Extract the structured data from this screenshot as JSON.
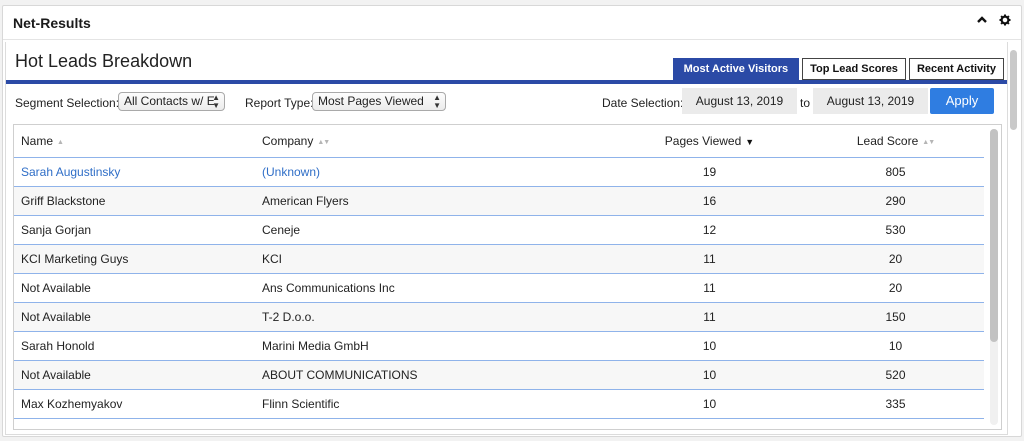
{
  "widget": {
    "title": "Net-Results"
  },
  "panel": {
    "title": "Hot Leads Breakdown"
  },
  "tabs": [
    {
      "label": "Most Active Visitors",
      "active": true
    },
    {
      "label": "Top Lead Scores",
      "active": false
    },
    {
      "label": "Recent Activity",
      "active": false
    }
  ],
  "controls": {
    "segment_label": "Segment Selection:",
    "segment_value": "All Contacts w/ E",
    "report_label": "Report Type:",
    "report_value": "Most Pages Viewed",
    "date_label": "Date Selection:",
    "date_from": "August 13, 2019",
    "date_to_label": "to",
    "date_to": "August 13, 2019",
    "apply_label": "Apply"
  },
  "table": {
    "headers": {
      "name": "Name",
      "company": "Company",
      "pages": "Pages Viewed",
      "score": "Lead Score"
    },
    "rows": [
      {
        "name": "Sarah Augustinsky",
        "company": "(Unknown)",
        "pages": "19",
        "score": "805"
      },
      {
        "name": "Griff Blackstone",
        "company": "American Flyers",
        "pages": "16",
        "score": "290"
      },
      {
        "name": "Sanja Gorjan",
        "company": "Ceneje",
        "pages": "12",
        "score": "530"
      },
      {
        "name": "KCI Marketing Guys",
        "company": "KCI",
        "pages": "11",
        "score": "20"
      },
      {
        "name": "Not Available",
        "company": "Ans Communications Inc",
        "pages": "11",
        "score": "20"
      },
      {
        "name": "Not Available",
        "company": "T-2 D.o.o.",
        "pages": "11",
        "score": "150"
      },
      {
        "name": "Sarah Honold",
        "company": "Marini Media GmbH",
        "pages": "10",
        "score": "10"
      },
      {
        "name": "Not Available",
        "company": "ABOUT COMMUNICATIONS",
        "pages": "10",
        "score": "520"
      },
      {
        "name": "Max Kozhemyakov",
        "company": "Flinn Scientific",
        "pages": "10",
        "score": "335"
      }
    ]
  },
  "icons": {
    "collapse": "chevron-up-icon",
    "settings": "gear-icon"
  },
  "colors": {
    "accent": "#2b4aa6",
    "apply": "#2f7de1",
    "link": "#2f6ec7"
  }
}
